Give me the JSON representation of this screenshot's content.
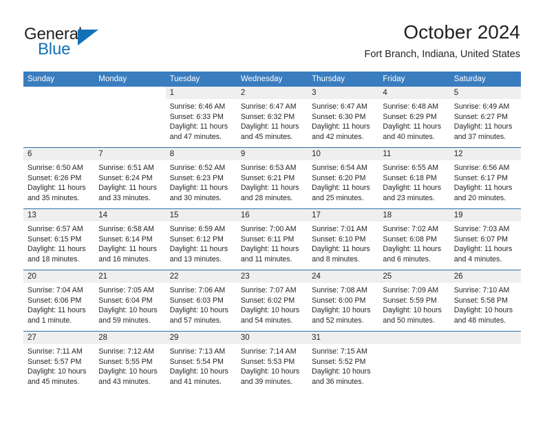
{
  "brand": {
    "word1": "General",
    "word2": "Blue",
    "triangle_color": "#1271b7"
  },
  "header": {
    "month_title": "October 2024",
    "location": "Fort Branch, Indiana, United States"
  },
  "theme": {
    "header_blue": "#3a7dbf",
    "rule_blue": "#2b6ca8",
    "band_gray": "#efefef",
    "text": "#231f20"
  },
  "calendar": {
    "weekday_headers": [
      "Sunday",
      "Monday",
      "Tuesday",
      "Wednesday",
      "Thursday",
      "Friday",
      "Saturday"
    ],
    "weeks": [
      [
        {
          "type": "blank"
        },
        {
          "type": "blank"
        },
        {
          "type": "day",
          "day": "1",
          "sunrise": "Sunrise: 6:46 AM",
          "sunset": "Sunset: 6:33 PM",
          "daylight1": "Daylight: 11 hours",
          "daylight2": "and 47 minutes."
        },
        {
          "type": "day",
          "day": "2",
          "sunrise": "Sunrise: 6:47 AM",
          "sunset": "Sunset: 6:32 PM",
          "daylight1": "Daylight: 11 hours",
          "daylight2": "and 45 minutes."
        },
        {
          "type": "day",
          "day": "3",
          "sunrise": "Sunrise: 6:47 AM",
          "sunset": "Sunset: 6:30 PM",
          "daylight1": "Daylight: 11 hours",
          "daylight2": "and 42 minutes."
        },
        {
          "type": "day",
          "day": "4",
          "sunrise": "Sunrise: 6:48 AM",
          "sunset": "Sunset: 6:29 PM",
          "daylight1": "Daylight: 11 hours",
          "daylight2": "and 40 minutes."
        },
        {
          "type": "day",
          "day": "5",
          "sunrise": "Sunrise: 6:49 AM",
          "sunset": "Sunset: 6:27 PM",
          "daylight1": "Daylight: 11 hours",
          "daylight2": "and 37 minutes."
        }
      ],
      [
        {
          "type": "day",
          "day": "6",
          "sunrise": "Sunrise: 6:50 AM",
          "sunset": "Sunset: 6:26 PM",
          "daylight1": "Daylight: 11 hours",
          "daylight2": "and 35 minutes."
        },
        {
          "type": "day",
          "day": "7",
          "sunrise": "Sunrise: 6:51 AM",
          "sunset": "Sunset: 6:24 PM",
          "daylight1": "Daylight: 11 hours",
          "daylight2": "and 33 minutes."
        },
        {
          "type": "day",
          "day": "8",
          "sunrise": "Sunrise: 6:52 AM",
          "sunset": "Sunset: 6:23 PM",
          "daylight1": "Daylight: 11 hours",
          "daylight2": "and 30 minutes."
        },
        {
          "type": "day",
          "day": "9",
          "sunrise": "Sunrise: 6:53 AM",
          "sunset": "Sunset: 6:21 PM",
          "daylight1": "Daylight: 11 hours",
          "daylight2": "and 28 minutes."
        },
        {
          "type": "day",
          "day": "10",
          "sunrise": "Sunrise: 6:54 AM",
          "sunset": "Sunset: 6:20 PM",
          "daylight1": "Daylight: 11 hours",
          "daylight2": "and 25 minutes."
        },
        {
          "type": "day",
          "day": "11",
          "sunrise": "Sunrise: 6:55 AM",
          "sunset": "Sunset: 6:18 PM",
          "daylight1": "Daylight: 11 hours",
          "daylight2": "and 23 minutes."
        },
        {
          "type": "day",
          "day": "12",
          "sunrise": "Sunrise: 6:56 AM",
          "sunset": "Sunset: 6:17 PM",
          "daylight1": "Daylight: 11 hours",
          "daylight2": "and 20 minutes."
        }
      ],
      [
        {
          "type": "day",
          "day": "13",
          "sunrise": "Sunrise: 6:57 AM",
          "sunset": "Sunset: 6:15 PM",
          "daylight1": "Daylight: 11 hours",
          "daylight2": "and 18 minutes."
        },
        {
          "type": "day",
          "day": "14",
          "sunrise": "Sunrise: 6:58 AM",
          "sunset": "Sunset: 6:14 PM",
          "daylight1": "Daylight: 11 hours",
          "daylight2": "and 16 minutes."
        },
        {
          "type": "day",
          "day": "15",
          "sunrise": "Sunrise: 6:59 AM",
          "sunset": "Sunset: 6:12 PM",
          "daylight1": "Daylight: 11 hours",
          "daylight2": "and 13 minutes."
        },
        {
          "type": "day",
          "day": "16",
          "sunrise": "Sunrise: 7:00 AM",
          "sunset": "Sunset: 6:11 PM",
          "daylight1": "Daylight: 11 hours",
          "daylight2": "and 11 minutes."
        },
        {
          "type": "day",
          "day": "17",
          "sunrise": "Sunrise: 7:01 AM",
          "sunset": "Sunset: 6:10 PM",
          "daylight1": "Daylight: 11 hours",
          "daylight2": "and 8 minutes."
        },
        {
          "type": "day",
          "day": "18",
          "sunrise": "Sunrise: 7:02 AM",
          "sunset": "Sunset: 6:08 PM",
          "daylight1": "Daylight: 11 hours",
          "daylight2": "and 6 minutes."
        },
        {
          "type": "day",
          "day": "19",
          "sunrise": "Sunrise: 7:03 AM",
          "sunset": "Sunset: 6:07 PM",
          "daylight1": "Daylight: 11 hours",
          "daylight2": "and 4 minutes."
        }
      ],
      [
        {
          "type": "day",
          "day": "20",
          "sunrise": "Sunrise: 7:04 AM",
          "sunset": "Sunset: 6:06 PM",
          "daylight1": "Daylight: 11 hours",
          "daylight2": "and 1 minute."
        },
        {
          "type": "day",
          "day": "21",
          "sunrise": "Sunrise: 7:05 AM",
          "sunset": "Sunset: 6:04 PM",
          "daylight1": "Daylight: 10 hours",
          "daylight2": "and 59 minutes."
        },
        {
          "type": "day",
          "day": "22",
          "sunrise": "Sunrise: 7:06 AM",
          "sunset": "Sunset: 6:03 PM",
          "daylight1": "Daylight: 10 hours",
          "daylight2": "and 57 minutes."
        },
        {
          "type": "day",
          "day": "23",
          "sunrise": "Sunrise: 7:07 AM",
          "sunset": "Sunset: 6:02 PM",
          "daylight1": "Daylight: 10 hours",
          "daylight2": "and 54 minutes."
        },
        {
          "type": "day",
          "day": "24",
          "sunrise": "Sunrise: 7:08 AM",
          "sunset": "Sunset: 6:00 PM",
          "daylight1": "Daylight: 10 hours",
          "daylight2": "and 52 minutes."
        },
        {
          "type": "day",
          "day": "25",
          "sunrise": "Sunrise: 7:09 AM",
          "sunset": "Sunset: 5:59 PM",
          "daylight1": "Daylight: 10 hours",
          "daylight2": "and 50 minutes."
        },
        {
          "type": "day",
          "day": "26",
          "sunrise": "Sunrise: 7:10 AM",
          "sunset": "Sunset: 5:58 PM",
          "daylight1": "Daylight: 10 hours",
          "daylight2": "and 48 minutes."
        }
      ],
      [
        {
          "type": "day",
          "day": "27",
          "sunrise": "Sunrise: 7:11 AM",
          "sunset": "Sunset: 5:57 PM",
          "daylight1": "Daylight: 10 hours",
          "daylight2": "and 45 minutes."
        },
        {
          "type": "day",
          "day": "28",
          "sunrise": "Sunrise: 7:12 AM",
          "sunset": "Sunset: 5:55 PM",
          "daylight1": "Daylight: 10 hours",
          "daylight2": "and 43 minutes."
        },
        {
          "type": "day",
          "day": "29",
          "sunrise": "Sunrise: 7:13 AM",
          "sunset": "Sunset: 5:54 PM",
          "daylight1": "Daylight: 10 hours",
          "daylight2": "and 41 minutes."
        },
        {
          "type": "day",
          "day": "30",
          "sunrise": "Sunrise: 7:14 AM",
          "sunset": "Sunset: 5:53 PM",
          "daylight1": "Daylight: 10 hours",
          "daylight2": "and 39 minutes."
        },
        {
          "type": "day",
          "day": "31",
          "sunrise": "Sunrise: 7:15 AM",
          "sunset": "Sunset: 5:52 PM",
          "daylight1": "Daylight: 10 hours",
          "daylight2": "and 36 minutes."
        },
        {
          "type": "empty"
        },
        {
          "type": "empty"
        }
      ]
    ]
  }
}
